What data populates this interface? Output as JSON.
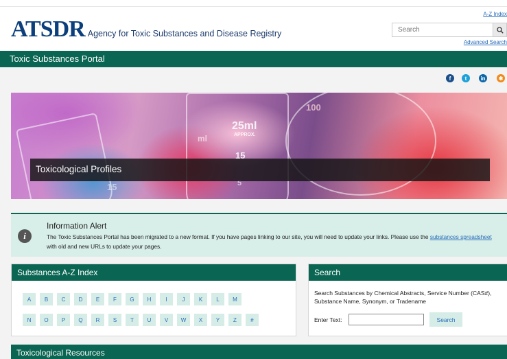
{
  "header": {
    "logo_mark": "ATSDR",
    "logo_text": "Agency for Toxic Substances and Disease Registry",
    "az_index_link": "A-Z Index",
    "search_placeholder": "Search",
    "advanced_search_link": "Advanced Search"
  },
  "portal_title": "Toxic Substances Portal",
  "social": [
    {
      "icon": "facebook-icon",
      "color": "#1b4f8a"
    },
    {
      "icon": "twitter-icon",
      "color": "#1da1d8"
    },
    {
      "icon": "linkedin-icon",
      "color": "#0d66a8"
    },
    {
      "icon": "syndication-icon",
      "color": "#f28a1b"
    }
  ],
  "hero": {
    "caption": "Toxicological Profiles",
    "beaker_marks": [
      "100",
      "25ml",
      "APPROX.",
      "15",
      "5",
      "ml",
      "15"
    ]
  },
  "alert": {
    "title": "Information Alert",
    "body_prefix": "The Toxic Substances Portal has been migrated to a new format. If you have pages linking to our site, you will need to update your links. Please use the ",
    "link_text": "substances spreadsheet ",
    "body_suffix": "with old and new URLs to update your pages."
  },
  "az_index": {
    "title": "Substances A-Z Index",
    "row1": [
      "A",
      "B",
      "C",
      "D",
      "E",
      "F",
      "G",
      "H",
      "I",
      "J",
      "K",
      "L",
      "M"
    ],
    "row2": [
      "N",
      "O",
      "P",
      "Q",
      "R",
      "S",
      "T",
      "U",
      "V",
      "W",
      "X",
      "Y",
      "Z",
      "#"
    ]
  },
  "search_panel": {
    "title": "Search",
    "description": "Search Substances by Chemical Abstracts, Service Number (CAS#), Substance Name, Synonym, or Tradename",
    "enter_label": "Enter Text:",
    "input_value": "",
    "button_label": "Search"
  },
  "resources_title": "Toxicological Resources",
  "colors": {
    "brand_green": "#0a6552",
    "logo_blue": "#0b3f7b",
    "link_blue": "#2a6ebb",
    "letter_bg": "#d6ece6"
  }
}
